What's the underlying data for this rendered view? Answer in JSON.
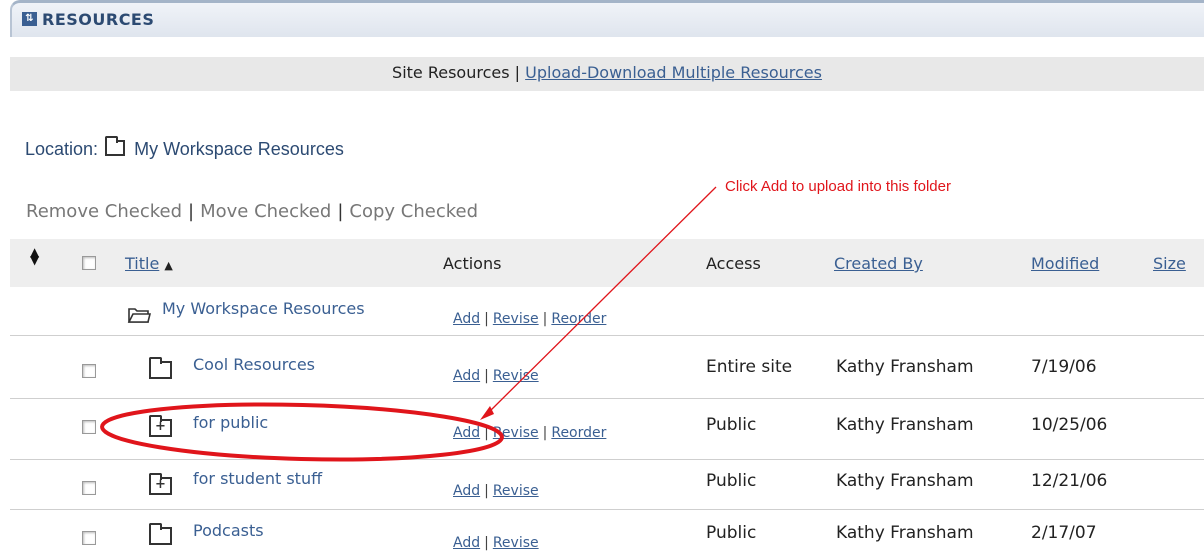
{
  "header": {
    "title": "RESOURCES",
    "icon": "resources-icon"
  },
  "subnav": {
    "current": "Site Resources",
    "separator": "|",
    "link": "Upload-Download Multiple Resources"
  },
  "location": {
    "label": "Location:",
    "folder": "My Workspace Resources"
  },
  "bulk_actions": [
    "Remove Checked",
    "Move Checked",
    "Copy Checked"
  ],
  "annotation": {
    "text": "Click Add to upload into this folder",
    "color": "#e0151b"
  },
  "table": {
    "headers": {
      "title": "Title",
      "actions": "Actions",
      "access": "Access",
      "created_by": "Created By",
      "modified": "Modified",
      "size": "Size"
    },
    "root": {
      "title": "My Workspace Resources",
      "actions": [
        "Add",
        "Revise",
        "Reorder"
      ]
    },
    "rows": [
      {
        "title": "Cool Resources",
        "icon": "folder-icon",
        "actions": [
          "Add",
          "Revise"
        ],
        "access": "Entire site",
        "created_by": "Kathy Fransham",
        "modified": "7/19/06"
      },
      {
        "title": "for public",
        "icon": "folder-plus-icon",
        "actions": [
          "Add",
          "Revise",
          "Reorder"
        ],
        "access": "Public",
        "created_by": "Kathy Fransham",
        "modified": "10/25/06"
      },
      {
        "title": "for student stuff",
        "icon": "folder-plus-icon",
        "actions": [
          "Add",
          "Revise"
        ],
        "access": "Public",
        "created_by": "Kathy Fransham",
        "modified": "12/21/06"
      },
      {
        "title": "Podcasts",
        "icon": "folder-icon",
        "actions": [
          "Add",
          "Revise"
        ],
        "access": "Public",
        "created_by": "Kathy Fransham",
        "modified": "2/17/07"
      }
    ]
  },
  "colors": {
    "link": "#3a5f92",
    "header_bg": "#eeeeee",
    "annotation": "#e0151b"
  }
}
